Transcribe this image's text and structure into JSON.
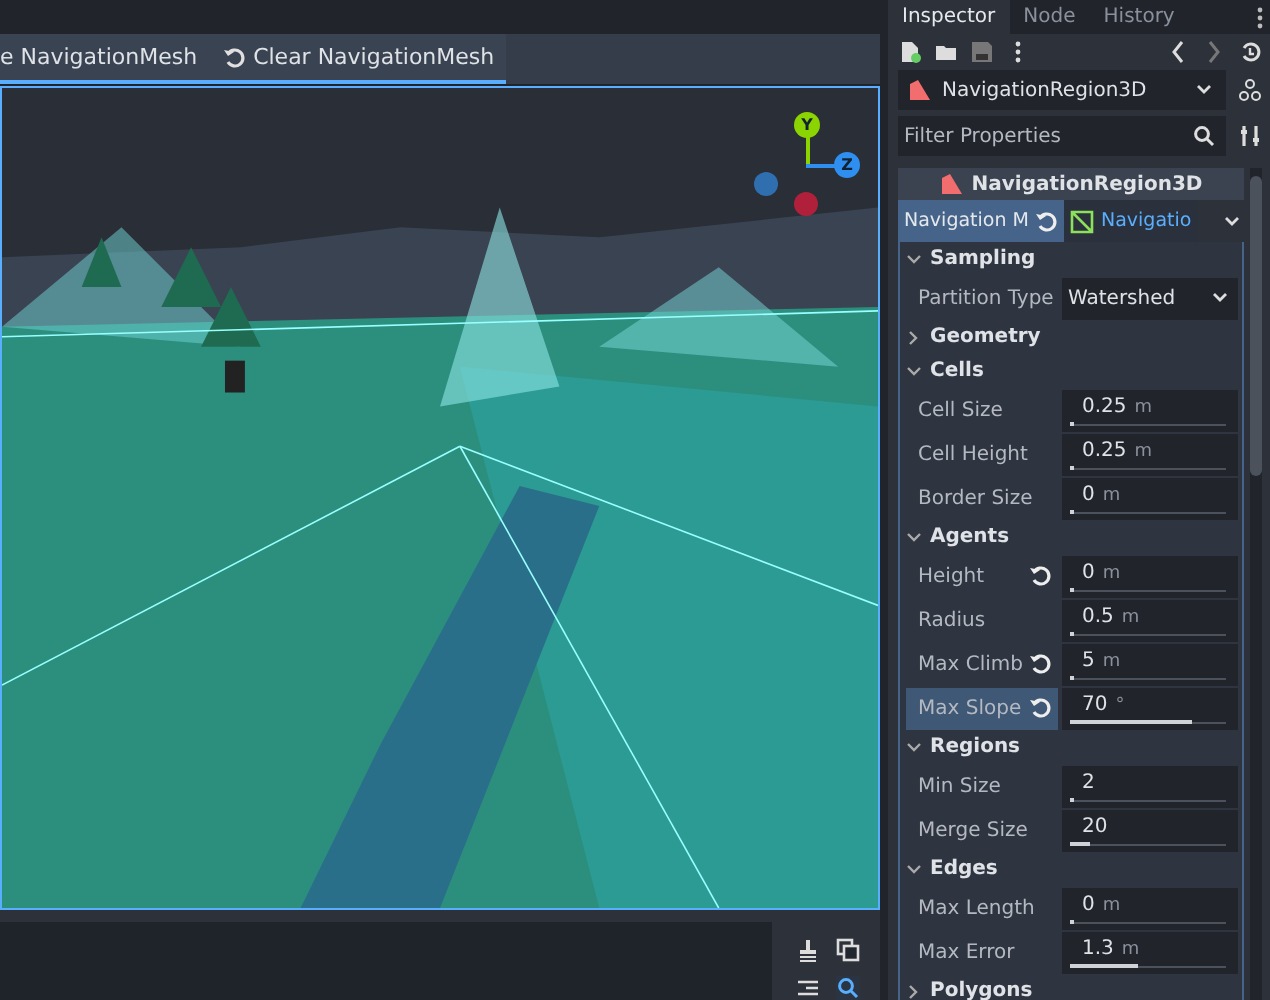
{
  "toolbar": {
    "buttons": [
      {
        "label": "e NavigationMesh",
        "kind": "bake"
      },
      {
        "label": "Clear NavigationMesh",
        "kind": "clear"
      }
    ]
  },
  "gizmo": {
    "axes": [
      {
        "label": "Y",
        "color": "#8cd400"
      },
      {
        "label": "Z",
        "color": "#2f8ff0"
      }
    ]
  },
  "inspector": {
    "tabs": [
      {
        "label": "Inspector",
        "selected": true
      },
      {
        "label": "Node",
        "selected": false
      },
      {
        "label": "History",
        "selected": false
      }
    ],
    "node_selector": "NavigationRegion3D",
    "filter": {
      "placeholder": "Filter Properties"
    },
    "header": "NavigationRegion3D",
    "resource_tabs": [
      {
        "label": "Navigation M",
        "selected": true
      },
      {
        "label": "Navigatio",
        "selected": false
      }
    ],
    "sections": [
      {
        "title": "Sampling",
        "expanded": true,
        "properties": [
          {
            "label": "Partition Type",
            "kind": "dropdown",
            "value": "Watershed"
          }
        ]
      },
      {
        "title": "Geometry",
        "expanded": false
      },
      {
        "title": "Cells",
        "expanded": true,
        "properties": [
          {
            "label": "Cell Size",
            "kind": "slider",
            "value": "0.25",
            "unit": "m",
            "level": 0.02,
            "revertible": false,
            "selected": false
          },
          {
            "label": "Cell Height",
            "kind": "slider",
            "value": "0.25",
            "unit": "m",
            "level": 0.02,
            "revertible": false,
            "selected": false
          },
          {
            "label": "Border Size",
            "kind": "slider",
            "value": "0",
            "unit": "m",
            "level": 0.0,
            "revertible": false,
            "selected": false
          }
        ]
      },
      {
        "title": "Agents",
        "expanded": true,
        "properties": [
          {
            "label": "Height",
            "kind": "slider",
            "value": "0",
            "unit": "m",
            "level": 0.0,
            "revertible": true,
            "selected": false
          },
          {
            "label": "Radius",
            "kind": "slider",
            "value": "0.5",
            "unit": "m",
            "level": 0.01,
            "revertible": false,
            "selected": false
          },
          {
            "label": "Max Climb",
            "kind": "slider",
            "value": "5",
            "unit": "m",
            "level": 0.01,
            "revertible": true,
            "selected": false
          },
          {
            "label": "Max Slope",
            "kind": "slider",
            "value": "70",
            "unit": "°",
            "level": 0.78,
            "revertible": true,
            "selected": true
          }
        ]
      },
      {
        "title": "Regions",
        "expanded": true,
        "properties": [
          {
            "label": "Min Size",
            "kind": "slider",
            "value": "2",
            "level": 0.01,
            "revertible": false,
            "selected": false
          },
          {
            "label": "Merge Size",
            "kind": "slider",
            "value": "20",
            "level": 0.13,
            "revertible": false,
            "selected": false
          }
        ]
      },
      {
        "title": "Edges",
        "expanded": true,
        "properties": [
          {
            "label": "Max Length",
            "kind": "slider",
            "value": "0",
            "unit": "m",
            "level": 0.0,
            "revertible": false,
            "selected": false
          },
          {
            "label": "Max Error",
            "kind": "slider",
            "value": "1.3",
            "unit": "m",
            "level": 0.43,
            "revertible": false,
            "selected": false
          }
        ]
      },
      {
        "title": "Polygons",
        "expanded": false
      }
    ]
  }
}
